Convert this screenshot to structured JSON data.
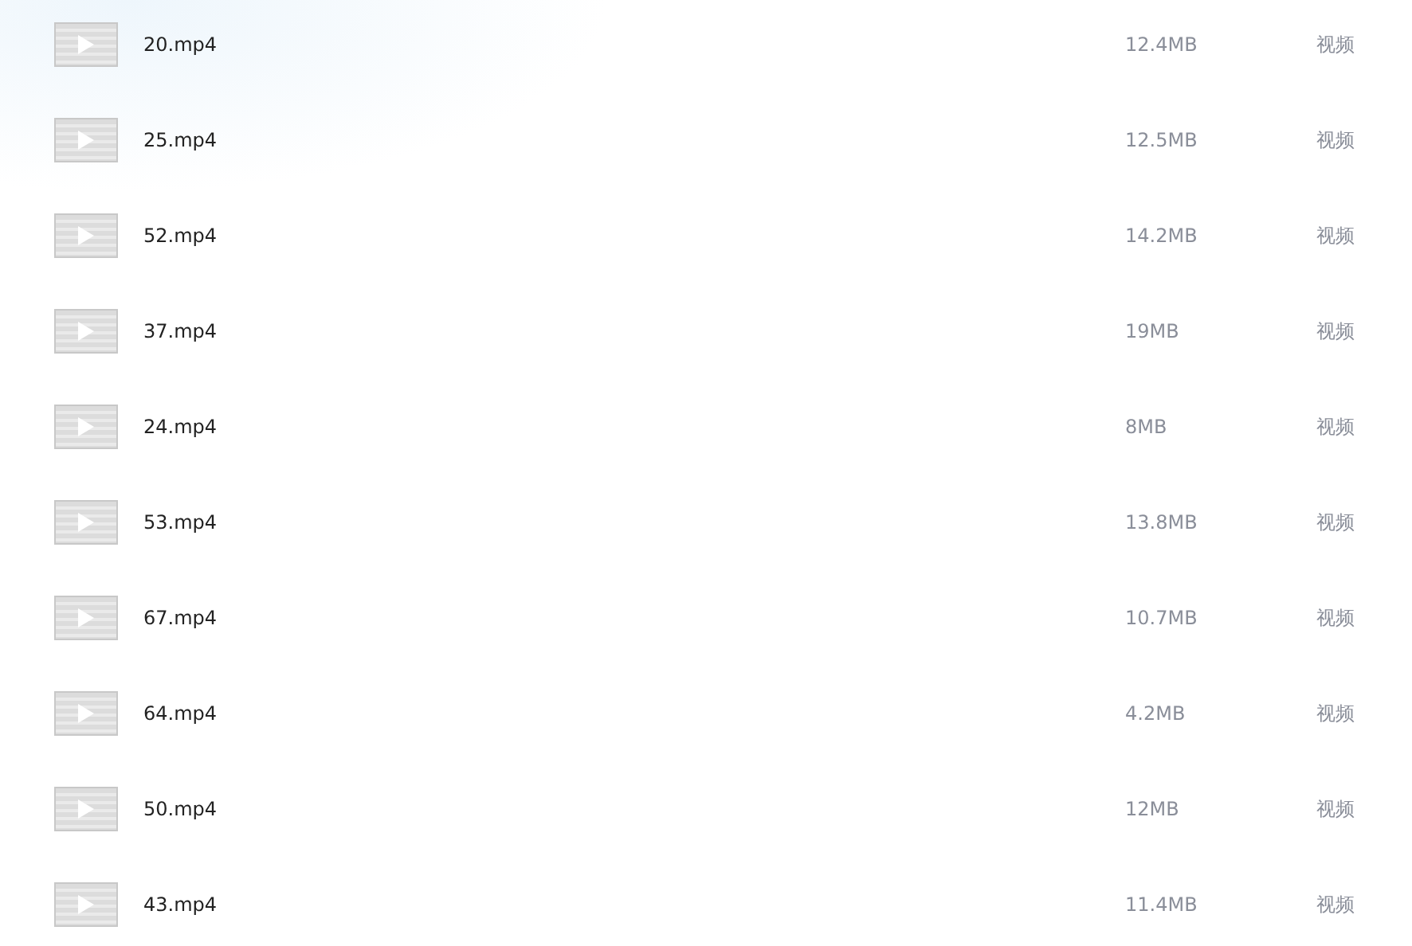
{
  "files": [
    {
      "name": "20.mp4",
      "size": "12.4MB",
      "type": "视频"
    },
    {
      "name": "25.mp4",
      "size": "12.5MB",
      "type": "视频"
    },
    {
      "name": "52.mp4",
      "size": "14.2MB",
      "type": "视频"
    },
    {
      "name": "37.mp4",
      "size": "19MB",
      "type": "视频"
    },
    {
      "name": "24.mp4",
      "size": "8MB",
      "type": "视频"
    },
    {
      "name": "53.mp4",
      "size": "13.8MB",
      "type": "视频"
    },
    {
      "name": "67.mp4",
      "size": "10.7MB",
      "type": "视频"
    },
    {
      "name": "64.mp4",
      "size": "4.2MB",
      "type": "视频"
    },
    {
      "name": "50.mp4",
      "size": "12MB",
      "type": "视频"
    },
    {
      "name": "43.mp4",
      "size": "11.4MB",
      "type": "视频"
    }
  ]
}
